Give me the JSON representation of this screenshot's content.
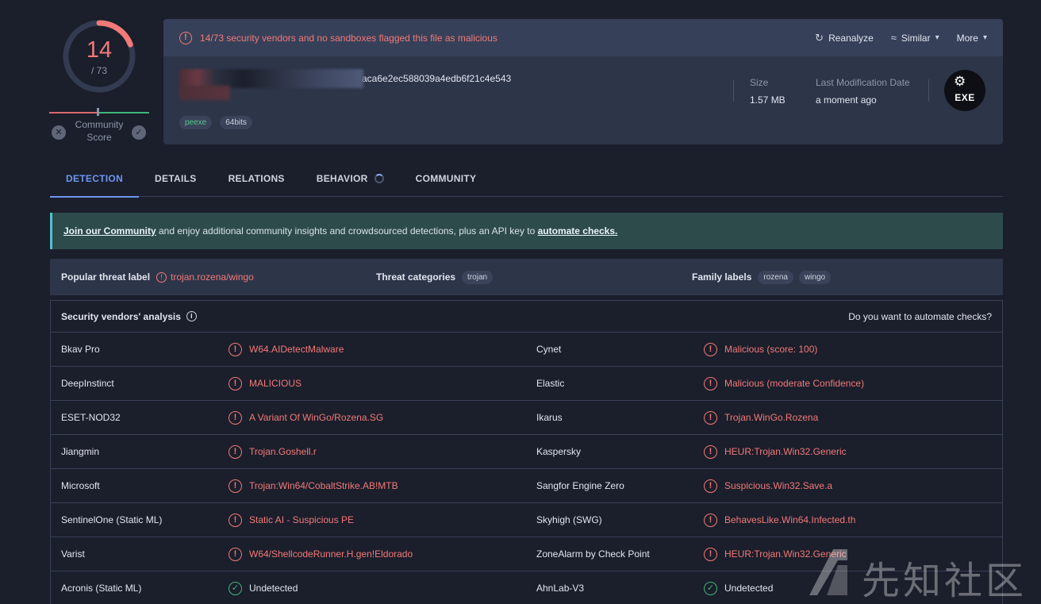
{
  "score": {
    "detections": "14",
    "total": "/ 73",
    "community_label": "Community Score",
    "ratio": 0.1918
  },
  "alert": {
    "text": "14/73 security vendors and no sandboxes flagged this file as malicious"
  },
  "actions": {
    "reanalyze": "Reanalyze",
    "similar": "Similar",
    "more": "More"
  },
  "file": {
    "hash_visible": "aca6e2ec588039a4edb6f21c4e543",
    "tags": [
      "peexe",
      "64bits"
    ],
    "size_label": "Size",
    "size_value": "1.57 MB",
    "lastmod_label": "Last Modification Date",
    "lastmod_value": "a moment ago",
    "type_badge": "EXE"
  },
  "tabs": [
    "DETECTION",
    "DETAILS",
    "RELATIONS",
    "BEHAVIOR",
    "COMMUNITY"
  ],
  "banner": {
    "link1": "Join our Community",
    "middle": " and enjoy additional community insights and crowdsourced detections, plus an API key to ",
    "link2": "automate checks."
  },
  "threat": {
    "popular_label": "Popular threat label",
    "popular_value": "trojan.rozena/wingo",
    "categories_label": "Threat categories",
    "categories": [
      "trojan"
    ],
    "family_label": "Family labels",
    "families": [
      "rozena",
      "wingo"
    ]
  },
  "vendors": {
    "title": "Security vendors' analysis",
    "automate": "Do you want to automate checks?",
    "rows": [
      {
        "v1": "Bkav Pro",
        "r1": "W64.AIDetectMalware",
        "s1": "bad",
        "v2": "Cynet",
        "r2": "Malicious (score: 100)",
        "s2": "bad"
      },
      {
        "v1": "DeepInstinct",
        "r1": "MALICIOUS",
        "s1": "bad",
        "v2": "Elastic",
        "r2": "Malicious (moderate Confidence)",
        "s2": "bad"
      },
      {
        "v1": "ESET-NOD32",
        "r1": "A Variant Of WinGo/Rozena.SG",
        "s1": "bad",
        "v2": "Ikarus",
        "r2": "Trojan.WinGo.Rozena",
        "s2": "bad"
      },
      {
        "v1": "Jiangmin",
        "r1": "Trojan.Goshell.r",
        "s1": "bad",
        "v2": "Kaspersky",
        "r2": "HEUR:Trojan.Win32.Generic",
        "s2": "bad"
      },
      {
        "v1": "Microsoft",
        "r1": "Trojan:Win64/CobaltStrike.AB!MTB",
        "s1": "bad",
        "v2": "Sangfor Engine Zero",
        "r2": "Suspicious.Win32.Save.a",
        "s2": "bad"
      },
      {
        "v1": "SentinelOne (Static ML)",
        "r1": "Static AI - Suspicious PE",
        "s1": "bad",
        "v2": "Skyhigh (SWG)",
        "r2": "BehavesLike.Win64.Infected.th",
        "s2": "bad"
      },
      {
        "v1": "Varist",
        "r1": "W64/ShellcodeRunner.H.gen!Eldorado",
        "s1": "bad",
        "v2": "ZoneAlarm by Check Point",
        "r2": "HEUR:Trojan.Win32.Generic",
        "s2": "bad"
      },
      {
        "v1": "Acronis (Static ML)",
        "r1": "Undetected",
        "s1": "good",
        "v2": "AhnLab-V3",
        "r2": "Undetected",
        "s2": "good"
      }
    ]
  },
  "watermark": {
    "text": "先知社区"
  },
  "colors": {
    "malicious": "#f17a78",
    "clean": "#3fb57a",
    "accent": "#6f97f2",
    "banner_border": "#4fc3c6"
  }
}
